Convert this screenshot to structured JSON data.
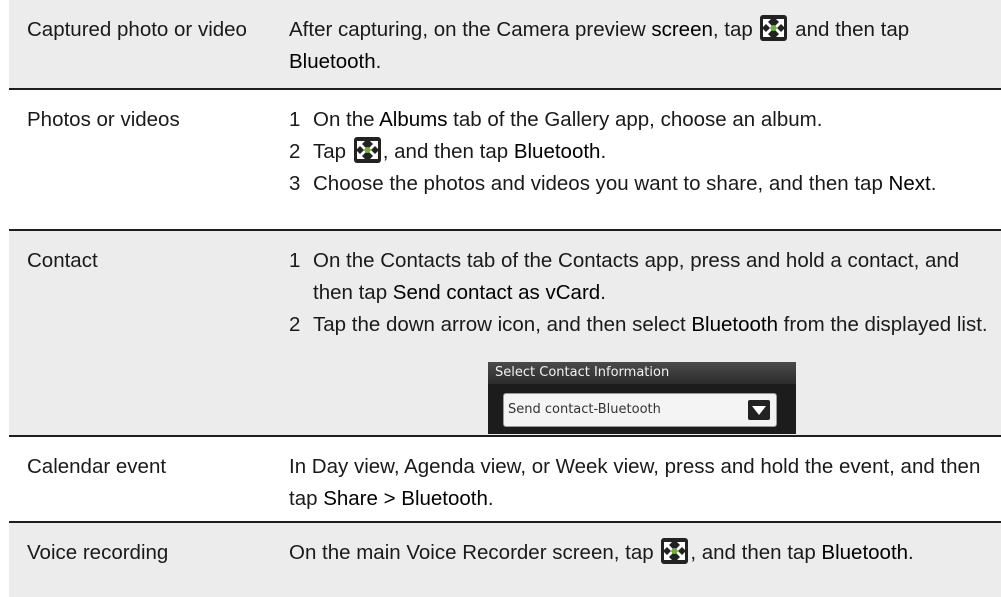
{
  "rows": [
    {
      "label": "Captured photo or video",
      "text": {
        "p1": "After capturing, on the Camera preview ",
        "b1": "screen",
        "p2": ", tap ",
        "p3": " and then tap ",
        "b2": "Bluetooth",
        "p4": "."
      }
    },
    {
      "label": "Photos or videos",
      "steps": [
        {
          "n": "1",
          "p1": "On the ",
          "b1": "Albums",
          "p2": " tab of the Gallery app, choose an album."
        },
        {
          "n": "2",
          "p1": "Tap ",
          "p2": ", and then tap ",
          "b1": "Bluetooth",
          "p3": "."
        },
        {
          "n": "3",
          "p1": "Choose the photos and videos you want to share, and then tap ",
          "b1": "Next",
          "p2": "."
        }
      ]
    },
    {
      "label": "Contact",
      "steps": [
        {
          "n": "1",
          "p1": "On the Contacts tab of the Contacts app, press and hold a contact, and then tap ",
          "b1": "Send contact as vCard",
          "p2": "."
        },
        {
          "n": "2",
          "p1": "Tap the down arrow icon, and then select ",
          "b1": "Bluetooth",
          "p2": " from the displayed list."
        }
      ],
      "ui": {
        "header": "Select Contact Information",
        "selected": "Send contact-Bluetooth"
      }
    },
    {
      "label": "Calendar event",
      "text": {
        "p1": "In Day view, Agenda view, or Week view, press and hold the event, and then tap ",
        "b1": "Share > Bluetooth",
        "p2": "."
      }
    },
    {
      "label": "Voice recording",
      "text": {
        "p1": "On the main Voice Recorder screen, tap ",
        "p2": ", and then tap ",
        "b1": "Bluetooth",
        "p3": "."
      }
    }
  ],
  "colors": {
    "shaded_row": "#ececec",
    "rule": "#1e1e1e",
    "text": "#1a1a1a"
  },
  "icons": {
    "share": "share-icon"
  }
}
